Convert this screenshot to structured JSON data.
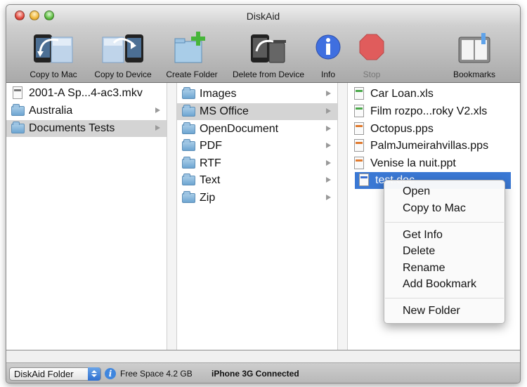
{
  "window": {
    "title": "DiskAid"
  },
  "toolbar": {
    "copy_to_mac": "Copy to Mac",
    "copy_to_device": "Copy to Device",
    "create_folder": "Create Folder",
    "delete_from_device": "Delete from Device",
    "info": "Info",
    "stop": "Stop",
    "bookmarks": "Bookmarks"
  },
  "column1": {
    "items": [
      {
        "label": "2001-A Sp...4-ac3.mkv",
        "type": "file"
      },
      {
        "label": "Australia",
        "type": "folder"
      },
      {
        "label": "Documents Tests",
        "type": "folder",
        "selected": true
      }
    ]
  },
  "column2": {
    "items": [
      {
        "label": "Images"
      },
      {
        "label": "MS Office",
        "selected": true
      },
      {
        "label": "OpenDocument"
      },
      {
        "label": "PDF"
      },
      {
        "label": "RTF"
      },
      {
        "label": "Text"
      },
      {
        "label": "Zip"
      }
    ]
  },
  "column3": {
    "items": [
      {
        "label": "Car Loan.xls",
        "icon": "excel-file-icon"
      },
      {
        "label": "Film rozpo...roky V2.xls",
        "icon": "excel-file-icon"
      },
      {
        "label": "Octopus.pps",
        "icon": "powerpoint-file-icon"
      },
      {
        "label": "PalmJumeirahvillas.pps",
        "icon": "powerpoint-file-icon"
      },
      {
        "label": "Venise la nuit.ppt",
        "icon": "powerpoint-file-icon"
      },
      {
        "label": "test.doc",
        "icon": "word-file-icon",
        "selected": true
      }
    ]
  },
  "context_menu": {
    "open": "Open",
    "copy_to_mac": "Copy to Mac",
    "get_info": "Get Info",
    "delete": "Delete",
    "rename": "Rename",
    "add_bookmark": "Add Bookmark",
    "new_folder": "New Folder"
  },
  "statusbar": {
    "location_select": "DiskAid Folder",
    "free_space": "Free Space 4.2 GB",
    "connection": "iPhone 3G Connected"
  },
  "colors": {
    "selection": "#3a78d4",
    "inactive_selection": "#d4d4d4",
    "add_green": "#47b53a",
    "stop_red": "#e05c5c",
    "info_blue": "#3f6fe0"
  }
}
